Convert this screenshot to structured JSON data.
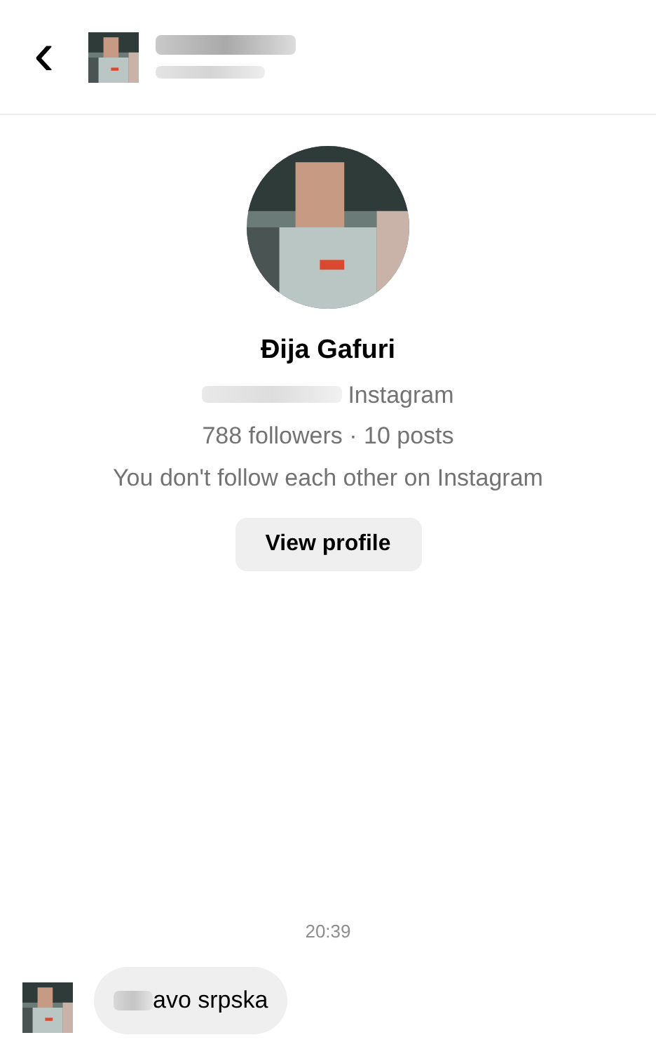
{
  "header": {
    "back": "‹"
  },
  "profile": {
    "name": "Đija Gafuri",
    "source": "Instagram",
    "stats": "788 followers · 10 posts",
    "relation": "You don't follow each other on Instagram",
    "button": "View profile"
  },
  "messages": [
    {
      "time": "20:39",
      "text": "avo srpska"
    }
  ]
}
